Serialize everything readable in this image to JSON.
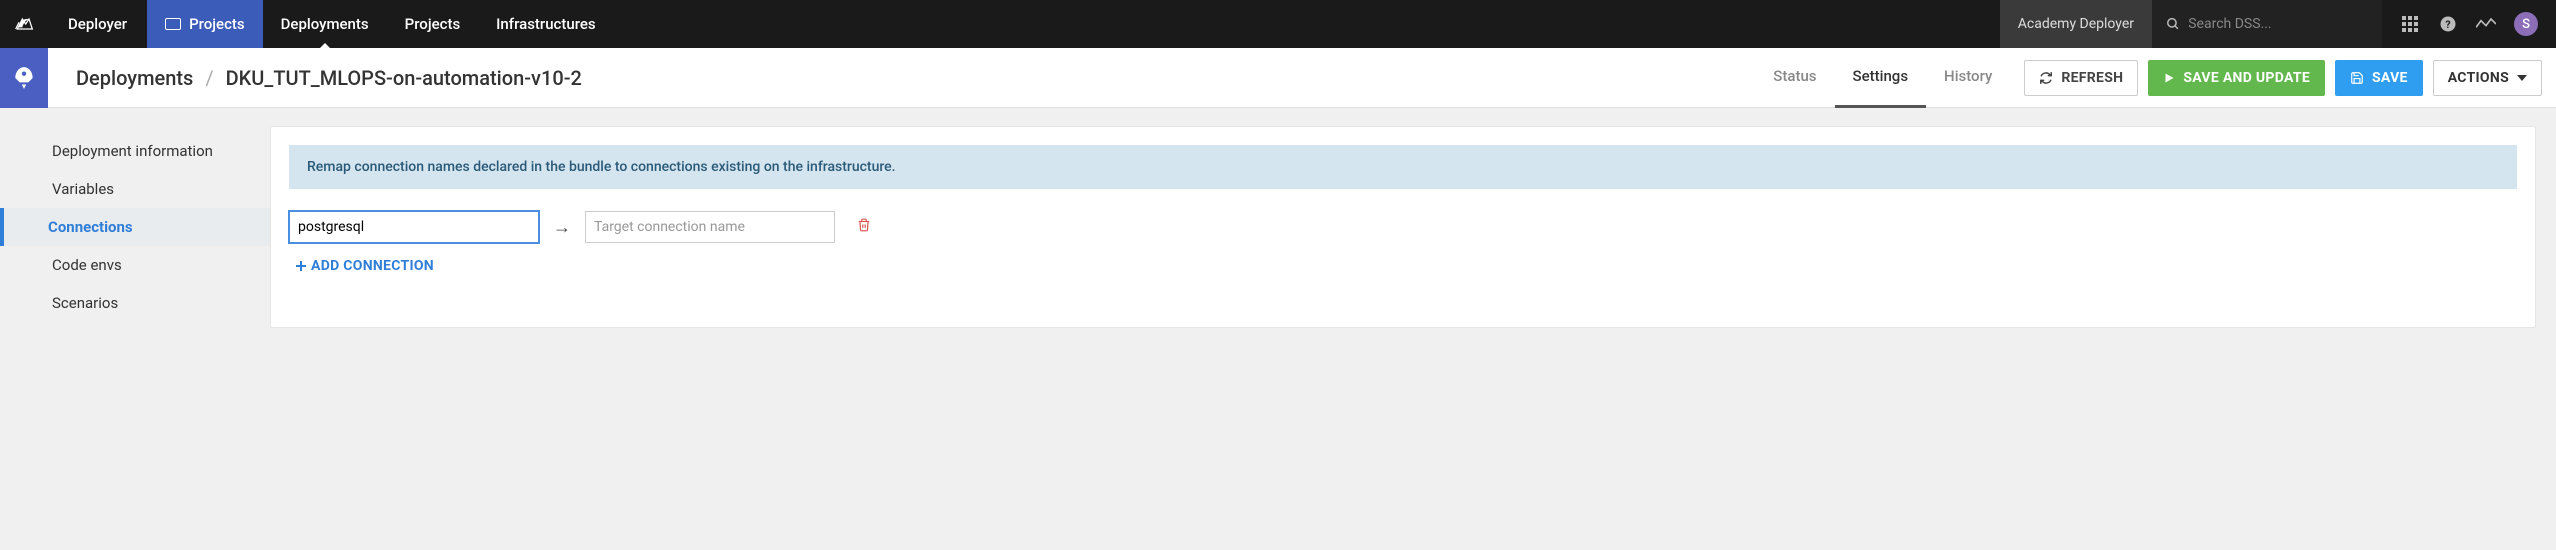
{
  "topbar": {
    "app": "Deployer",
    "tabs": [
      {
        "label": "Projects",
        "active": true
      },
      {
        "label": "Deployments",
        "caret": true
      },
      {
        "label": "Projects"
      },
      {
        "label": "Infrastructures"
      }
    ],
    "tenant": "Academy Deployer",
    "search_placeholder": "Search DSS...",
    "user_initial": "S"
  },
  "breadcrumb": {
    "root": "Deployments",
    "item": "DKU_TUT_MLOPS-on-automation-v10-2"
  },
  "subtabs": {
    "status": "Status",
    "settings": "Settings",
    "history": "History"
  },
  "buttons": {
    "refresh": "REFRESH",
    "save_update": "SAVE AND UPDATE",
    "save": "SAVE",
    "actions": "ACTIONS"
  },
  "sidenav": {
    "deployment_info": "Deployment information",
    "variables": "Variables",
    "connections": "Connections",
    "code_envs": "Code envs",
    "scenarios": "Scenarios"
  },
  "panel": {
    "info": "Remap connection names declared in the bundle to connections existing on the infrastructure.",
    "source_value": "postgresql",
    "target_placeholder": "Target connection name",
    "add_label": "ADD CONNECTION"
  }
}
